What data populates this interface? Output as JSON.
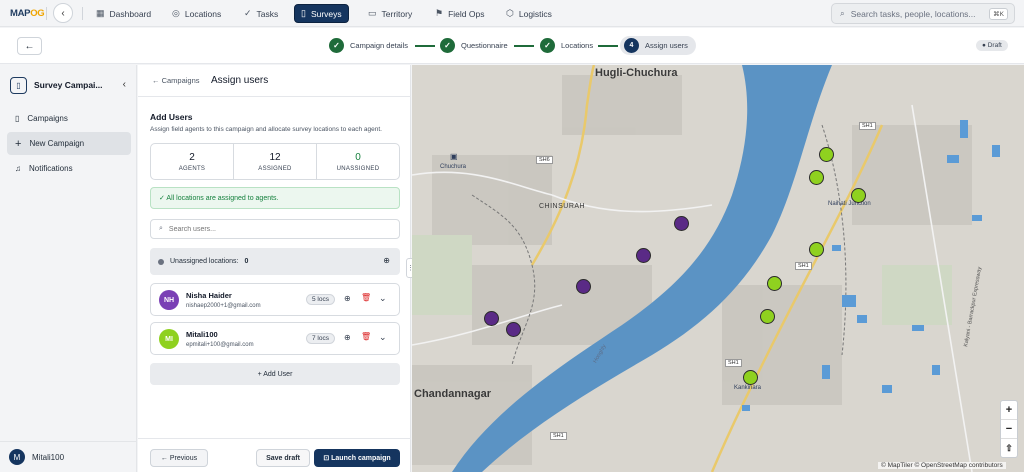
{
  "topnav": {
    "logo_main": "MAP",
    "logo_accent": "OG",
    "items": [
      {
        "label": "Dashboard",
        "icon": "dashboard-icon"
      },
      {
        "label": "Locations",
        "icon": "pin-icon"
      },
      {
        "label": "Tasks",
        "icon": "check-icon"
      },
      {
        "label": "Surveys",
        "icon": "clipboard-icon",
        "active": true
      },
      {
        "label": "Territory",
        "icon": "map-icon"
      },
      {
        "label": "Field Ops",
        "icon": "flag-icon"
      },
      {
        "label": "Logistics",
        "icon": "box-icon"
      }
    ],
    "search_placeholder": "Search tasks, people, locations...",
    "search_shortcut": "⌘K"
  },
  "steps": [
    {
      "label": "Campaign details",
      "state": "done"
    },
    {
      "label": "Questionnaire",
      "state": "done"
    },
    {
      "label": "Locations",
      "state": "done"
    },
    {
      "label": "Assign users",
      "number": "4",
      "state": "active"
    }
  ],
  "status_badge": "Draft",
  "sidebar": {
    "title": "Survey Campai...",
    "items": [
      {
        "label": "Campaigns",
        "icon": "clipboard-icon"
      },
      {
        "label": "New Campaign",
        "icon": "plus-icon",
        "active": true
      },
      {
        "label": "Notifications",
        "icon": "bell-icon"
      }
    ],
    "user_initial": "M",
    "user_name": "Mitali100"
  },
  "panel": {
    "breadcrumb": "← Campaigns",
    "title": "Assign users",
    "section_title": "Add Users",
    "section_desc": "Assign field agents to this campaign and allocate survey locations to each agent.",
    "stats": [
      {
        "value": "2",
        "label": "AGENTS"
      },
      {
        "value": "12",
        "label": "ASSIGNED"
      },
      {
        "value": "0",
        "label": "UNASSIGNED"
      }
    ],
    "alert": "✓ All locations are assigned to agents.",
    "search_placeholder": "Search users...",
    "unassigned_label": "Unassigned locations:",
    "unassigned_count": "0",
    "users": [
      {
        "initials": "NH",
        "name": "Nisha Haider",
        "email": "nishaep2000+1@gmail.com",
        "locs": "5 locs",
        "color": "#7a3fb5"
      },
      {
        "initials": "MI",
        "name": "Mitali100",
        "email": "epmitali+100@gmail.com",
        "locs": "7 locs",
        "color": "#8fd11f"
      }
    ],
    "add_user": "+ Add User",
    "prev_label": "← Previous",
    "draft_label": "Save draft",
    "launch_label": "⊡ Launch campaign"
  },
  "map": {
    "labels": {
      "hugli": "Hugli-Chuchura",
      "chinsurah": "CHINSURAH",
      "chandannagar": "Chandannagar",
      "chuchura": "Chuchura",
      "naihati": "Naihati Junction",
      "kankinara": "Kankinara",
      "hooghly": "Hooghly",
      "expressway": "Kalyani - Barrackpur Expressway"
    },
    "roads": {
      "sh6": "SH6",
      "sh1a": "SH1",
      "sh1b": "SH1",
      "sh1c": "SH1",
      "sh1d": "SH1"
    },
    "attribution": "© MapTiler © OpenStreetMap contributors",
    "zoom_in": "+",
    "zoom_out": "−",
    "compass": "⇧"
  }
}
